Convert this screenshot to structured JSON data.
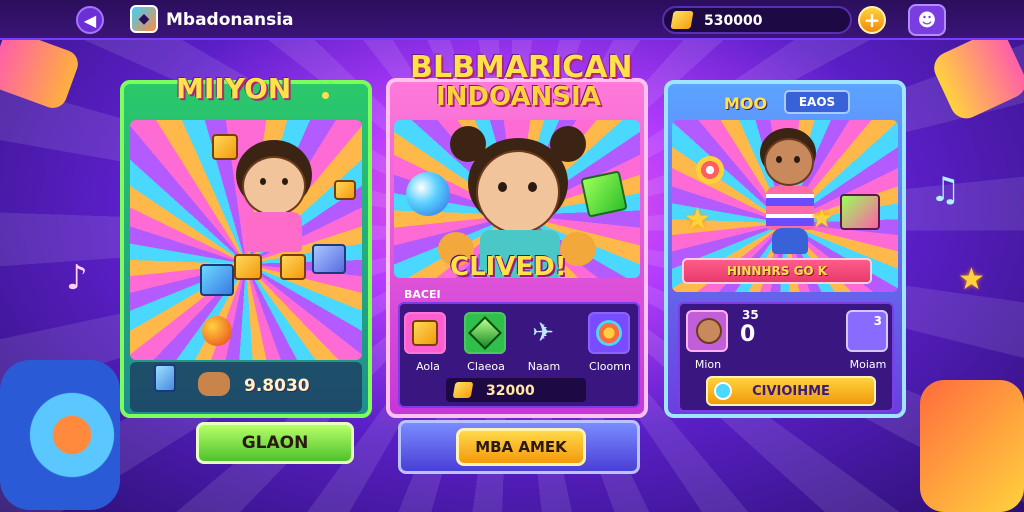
{
  "header": {
    "back_icon": "arrow-left-icon",
    "app_title": "Mbadonansia",
    "coins": "530000",
    "add_icon": "plus-icon",
    "profile_icon": "character-icon"
  },
  "panels": [
    {
      "title": "MIIYON",
      "value": "9.8030",
      "button_label": "GLAON"
    },
    {
      "title": "BLBMARICAN",
      "subtitle": "INDOANSIA",
      "banner": "CLIVED!",
      "section_label": "BACEI",
      "items": [
        {
          "label": "Aola",
          "icon": "cube-icon",
          "color": "#f29a0c"
        },
        {
          "label": "Claeoa",
          "icon": "gem-icon",
          "color": "#2fbf4a"
        },
        {
          "label": "Naam",
          "icon": "sword-icon",
          "color": "#5a9cff"
        },
        {
          "label": "Cloomn",
          "icon": "shield-icon",
          "color": "#7a4cff"
        }
      ],
      "coins": "32000",
      "button_label": "MBA AMEK"
    },
    {
      "title": "MOO",
      "tag": "EAOS",
      "banner": "HINNHRS GO K",
      "count": "0",
      "count_sub": "35",
      "avatar_label": "Mion",
      "item_label": "Moiam",
      "item_badge": "3",
      "action_label": "CIVIOIHME"
    }
  ]
}
